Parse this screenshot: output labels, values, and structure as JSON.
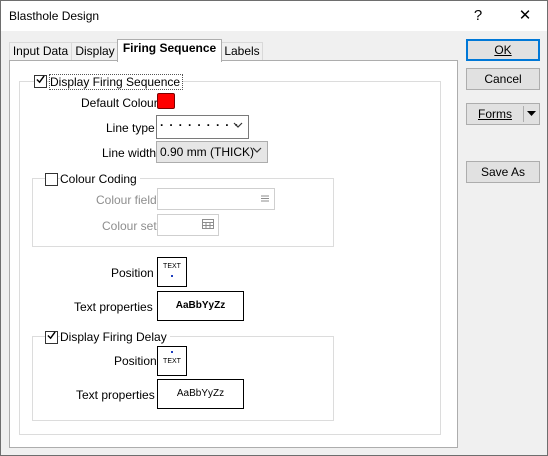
{
  "window": {
    "title": "Blasthole Design",
    "help": "?",
    "close": "✕"
  },
  "tabs": [
    {
      "label": "Input Data"
    },
    {
      "label": "Display"
    },
    {
      "label": "Firing Sequence"
    },
    {
      "label": "Labels"
    }
  ],
  "firing": {
    "display_label": "Display Firing Sequence",
    "display_checked": true,
    "default_colour_label": "Default Colour",
    "default_colour": "#ff0000",
    "line_type_label": "Line type",
    "line_type_value": "· · · · · · · · ·",
    "line_width_label": "Line width",
    "line_width_value": "0.90 mm (THICK)",
    "colour_coding_label": "Colour Coding",
    "colour_coding_checked": false,
    "colour_field_label": "Colour field",
    "colour_field_value": "",
    "colour_set_label": "Colour set",
    "colour_set_value": "",
    "position_label": "Position",
    "position_box_text": "TEXT",
    "text_properties_label": "Text properties",
    "text_properties_sample": "AaBbYyZz"
  },
  "delay": {
    "display_label": "Display Firing Delay",
    "display_checked": true,
    "position_label": "Position",
    "position_box_text": "TEXT",
    "text_properties_label": "Text properties",
    "text_properties_sample": "AaBbYyZz"
  },
  "buttons": {
    "ok": "OK",
    "cancel": "Cancel",
    "forms": "Forms",
    "save_as": "Save As"
  }
}
